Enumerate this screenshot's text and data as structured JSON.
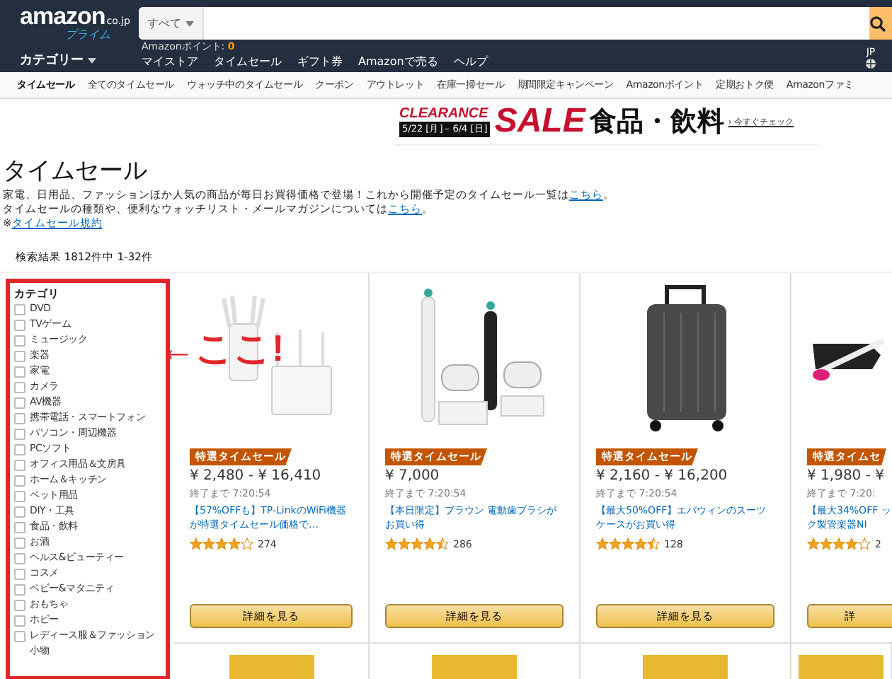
{
  "header": {
    "logo": "amazon",
    "logo_suffix": "co.jp",
    "logo_sub": "プライム",
    "search_scope": "すべて",
    "category_menu": "カテゴリー",
    "points_label": "Amazonポイント: ",
    "points_value": "0",
    "nav_links": [
      "マイストア",
      "タイムセール",
      "ギフト券",
      "Amazonで売る",
      "ヘルプ"
    ],
    "locale": "JP"
  },
  "subnav": [
    {
      "label": "タイムセール",
      "selected": true
    },
    {
      "label": "全てのタイムセール",
      "selected": false
    },
    {
      "label": "ウォッチ中のタイムセール",
      "selected": false
    },
    {
      "label": "クーポン",
      "selected": false
    },
    {
      "label": "アウトレット",
      "selected": false
    },
    {
      "label": "在庫一掃セール",
      "selected": false
    },
    {
      "label": "期間限定キャンペーン",
      "selected": false
    },
    {
      "label": "Amazonポイント",
      "selected": false
    },
    {
      "label": "定期おトク便",
      "selected": false
    },
    {
      "label": "Amazonファミ",
      "selected": false
    }
  ],
  "banner": {
    "clearance": "CLEARANCE",
    "dates": "5/22 [月]－6/4 [日]",
    "sale": "SALE",
    "category": "食品・飲料",
    "link": "› 今すぐチェック"
  },
  "page_title": "タイムセール",
  "intro": [
    {
      "text": "家電、日用品、ファッションほか人気の商品が毎日お買得価格で登場！これから開催予定のタイムセール一覧は",
      "link": "こちら",
      "after": "。"
    },
    {
      "text": "タイムセールの種類や、便利なウォッチリスト・メールマガジンについては",
      "link": "こちら",
      "after": "。"
    }
  ],
  "terms": {
    "prefix": "※",
    "link": "タイムセール規約"
  },
  "results": "検索結果 1812件中 1-32件",
  "sidebar": {
    "title": "カテゴリ",
    "items": [
      {
        "label": "DVD",
        "checked": false
      },
      {
        "label": "TVゲーム",
        "checked": false
      },
      {
        "label": "ミュージック",
        "checked": false
      },
      {
        "label": "楽器",
        "checked": false
      },
      {
        "label": "家電",
        "checked": false
      },
      {
        "label": "カメラ",
        "checked": false
      },
      {
        "label": "AV機器",
        "checked": false
      },
      {
        "label": "携帯電話・スマートフォン",
        "checked": false
      },
      {
        "label": "パソコン・周辺機器",
        "checked": false
      },
      {
        "label": "PCソフト",
        "checked": false
      },
      {
        "label": "オフィス用品＆文房具",
        "checked": false
      },
      {
        "label": "ホーム＆キッチン",
        "checked": false
      },
      {
        "label": "ペット用品",
        "checked": false
      },
      {
        "label": "DIY・工具",
        "checked": false
      },
      {
        "label": "食品・飲料",
        "checked": false
      },
      {
        "label": "お酒",
        "checked": false
      },
      {
        "label": "ヘルス&ビューティー",
        "checked": false
      },
      {
        "label": "コスメ",
        "checked": false
      },
      {
        "label": "ベビー&マタニティ",
        "checked": false
      },
      {
        "label": "おもちゃ",
        "checked": false
      },
      {
        "label": "ホビー",
        "checked": false
      },
      {
        "label": "レディース服＆ファッション小物",
        "checked": false
      }
    ]
  },
  "annotation": "←ここ!",
  "products": [
    {
      "kind": "router",
      "badge": "特選タイムセール",
      "price": "¥ 2,480 - ¥ 16,410",
      "timer": "終了まで 7:20:54",
      "title": "【57%OFFも】TP-LinkのWiFi機器が特選タイムセール価格で…",
      "stars": 4,
      "reviews": "274",
      "button": "詳細を見る"
    },
    {
      "kind": "toothbrush",
      "badge": "特選タイムセール",
      "price": "¥ 7,000",
      "timer": "終了まで 7:20:54",
      "title": "【本日限定】ブラウン 電動歯ブラシがお買い得",
      "stars": 4.5,
      "reviews": "286",
      "button": "詳細を見る"
    },
    {
      "kind": "suitcase",
      "badge": "特選タイムセール",
      "price": "¥ 2,160 - ¥ 16,200",
      "timer": "終了まで 7:20:54",
      "title": "【最大50%OFF】エバウィンのスーツケースがお買い得",
      "stars": 4.5,
      "reviews": "128",
      "button": "詳細を見る"
    },
    {
      "kind": "instrument",
      "badge": "特選タイムセ",
      "price": "¥ 1,980 - ¥",
      "timer": "終了まで 7:20:",
      "title": "【最大34%OFF ック製管楽器NI",
      "stars": 4,
      "reviews": "2",
      "button": "詳"
    }
  ]
}
